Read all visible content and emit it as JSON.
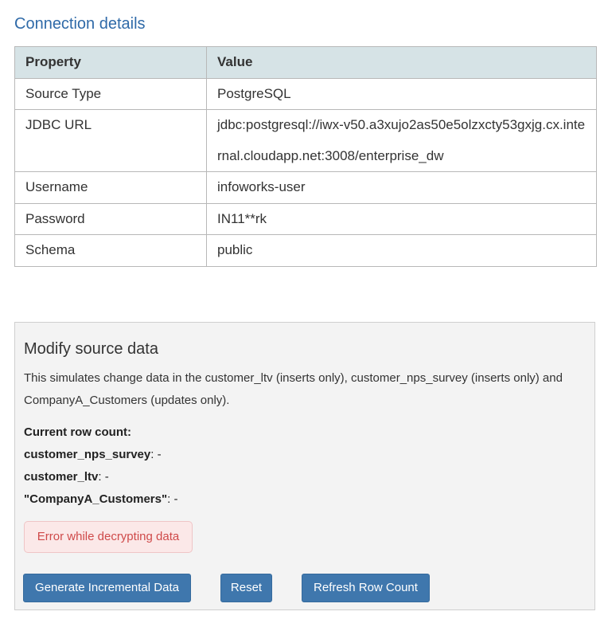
{
  "connection": {
    "title": "Connection details",
    "headers": {
      "property": "Property",
      "value": "Value"
    },
    "rows": [
      {
        "property": "Source Type",
        "value": "PostgreSQL"
      },
      {
        "property": "JDBC URL",
        "value": "jdbc:postgresql://iwx-v50.a3xujo2as50e5olzxcty53gxjg.cx.internal.cloudapp.net:3008/enterprise_dw"
      },
      {
        "property": "Username",
        "value": "infoworks-user"
      },
      {
        "property": "Password",
        "value": "IN11**rk"
      },
      {
        "property": "Schema",
        "value": "public"
      }
    ]
  },
  "modify": {
    "title": "Modify source data",
    "description": "This simulates change data in the customer_ltv (inserts only), customer_nps_survey (inserts only) and CompanyA_Customers (updates only).",
    "row_count_heading": "Current row count:",
    "counts": [
      {
        "name": "customer_nps_survey",
        "value": ": -"
      },
      {
        "name": "customer_ltv",
        "value": ": -"
      },
      {
        "name": "\"CompanyA_Customers\"",
        "value": ": -"
      }
    ],
    "error": "Error while decrypting data",
    "buttons": {
      "generate": "Generate Incremental Data",
      "reset": "Reset",
      "refresh": "Refresh Row Count"
    }
  }
}
